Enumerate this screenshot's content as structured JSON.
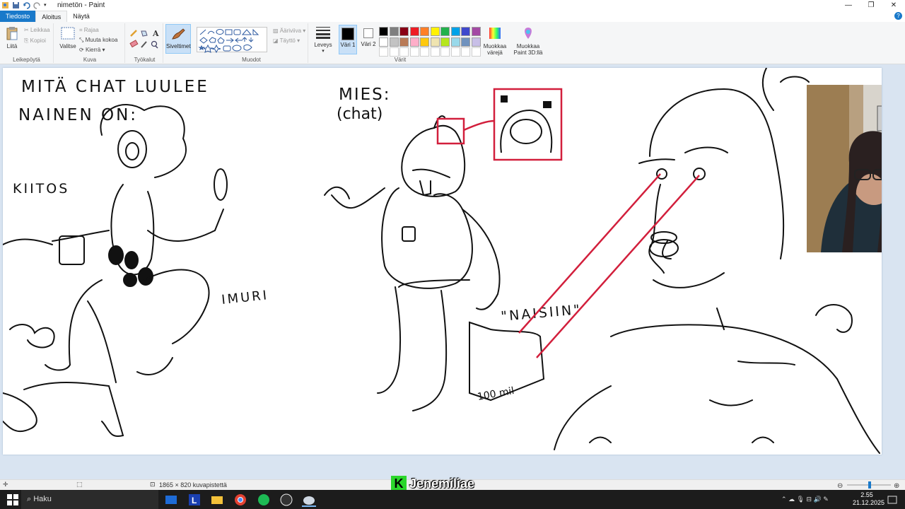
{
  "window": {
    "title": "nimetön - Paint"
  },
  "tabs": [
    {
      "label": "Tiedosto"
    },
    {
      "label": "Aloitus"
    },
    {
      "label": "Näytä"
    }
  ],
  "ribbon": {
    "clipboard": {
      "group_label": "Leikepöytä",
      "paste": "Liitä",
      "cut": "Leikkaa",
      "copy": "Kopioi"
    },
    "image": {
      "group_label": "Kuva",
      "select": "Valitse",
      "crop": "Rajaa",
      "resize": "Muuta kokoa",
      "rotate": "Kierrä"
    },
    "tools": {
      "group_label": "Työkalut"
    },
    "brushes": {
      "label": "Siveltimet"
    },
    "shapes": {
      "group_label": "Muodot",
      "outline": "Ääriviiva",
      "fill": "Täyttö"
    },
    "size": {
      "label": "Leveys"
    },
    "colors": {
      "group_label": "Värit",
      "color1": "Väri 1",
      "color2": "Väri 2",
      "edit_colors": "Muokkaa värejä",
      "paint3d": "Muokkaa Paint 3D:llä",
      "row1": [
        "#000000",
        "#7f7f7f",
        "#880015",
        "#ed1c24",
        "#ff7f27",
        "#fff200",
        "#22b14c",
        "#00a2e8",
        "#3f48cc",
        "#a349a4"
      ],
      "row2": [
        "#ffffff",
        "#c3c3c3",
        "#b97a57",
        "#ffaec9",
        "#ffc90e",
        "#efe4b0",
        "#b5e61d",
        "#99d9ea",
        "#7092be",
        "#c8bfe7"
      ]
    }
  },
  "drawing": {
    "left_title_1": "MITÄ CHAT LUULEE",
    "left_title_2": "NAINEN ON:",
    "kiitos": "KIITOS",
    "imuri": "IMURI",
    "mies": "MIES:",
    "chat": "(chat)",
    "naisiin": "\"NAISIIN\"",
    "money": "100 mil"
  },
  "status": {
    "dimensions": "1865 × 820 kuvapistettä"
  },
  "overlay": {
    "letter": "K",
    "name": "Jenemiliae"
  },
  "taskbar": {
    "search": "Haku",
    "time": "2.55",
    "date": "21.12.2025"
  }
}
